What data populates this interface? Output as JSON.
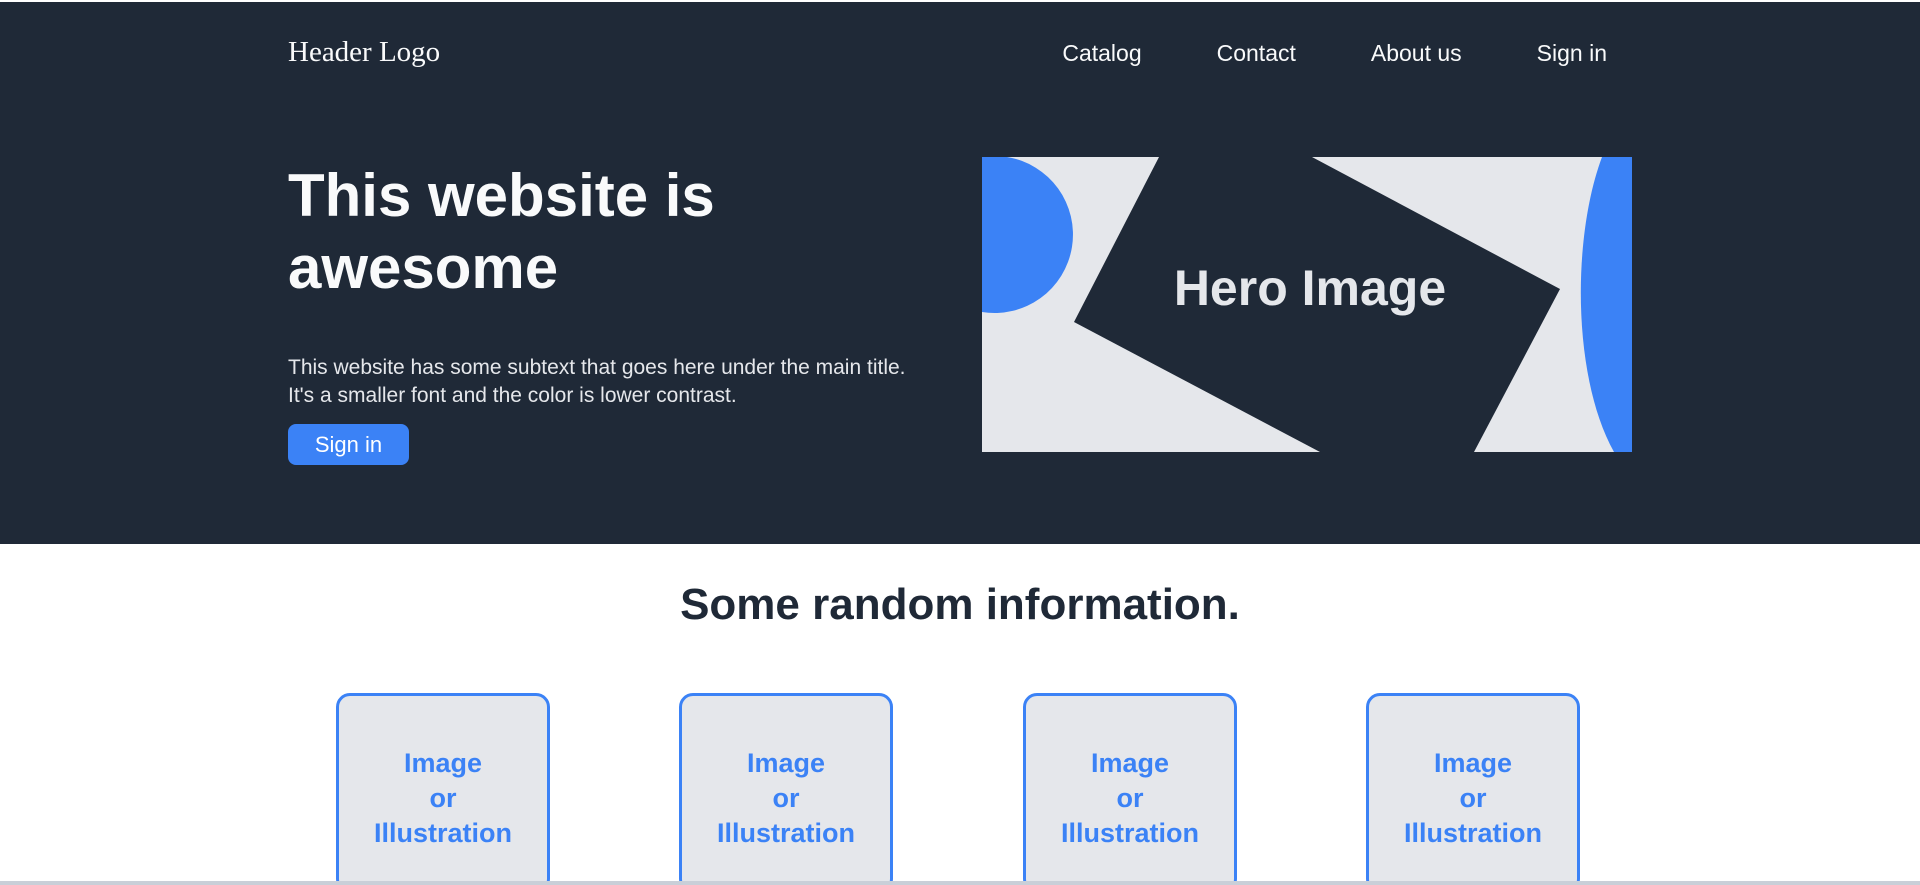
{
  "header": {
    "logo": "Header Logo",
    "nav": [
      "Catalog",
      "Contact",
      "About us",
      "Sign in"
    ]
  },
  "hero": {
    "title": "This website is awesome",
    "subtext_line1": "This website has some subtext that goes here under the main title.",
    "subtext_line2": "It's a smaller font and the color is lower contrast.",
    "button_label": "Sign in",
    "image_label": "Hero Image"
  },
  "info": {
    "title": "Some random information.",
    "cards": [
      {
        "lines": [
          "Image",
          "or",
          "Illustration"
        ]
      },
      {
        "lines": [
          "Image",
          "or",
          "Illustration"
        ]
      },
      {
        "lines": [
          "Image",
          "or",
          "Illustration"
        ]
      },
      {
        "lines": [
          "Image",
          "or",
          "Illustration"
        ]
      }
    ]
  },
  "colors": {
    "hero_bg": "#1f2937",
    "accent": "#3b82f6",
    "light_gray": "#e5e7eb",
    "text_light": "#f9fafb"
  }
}
